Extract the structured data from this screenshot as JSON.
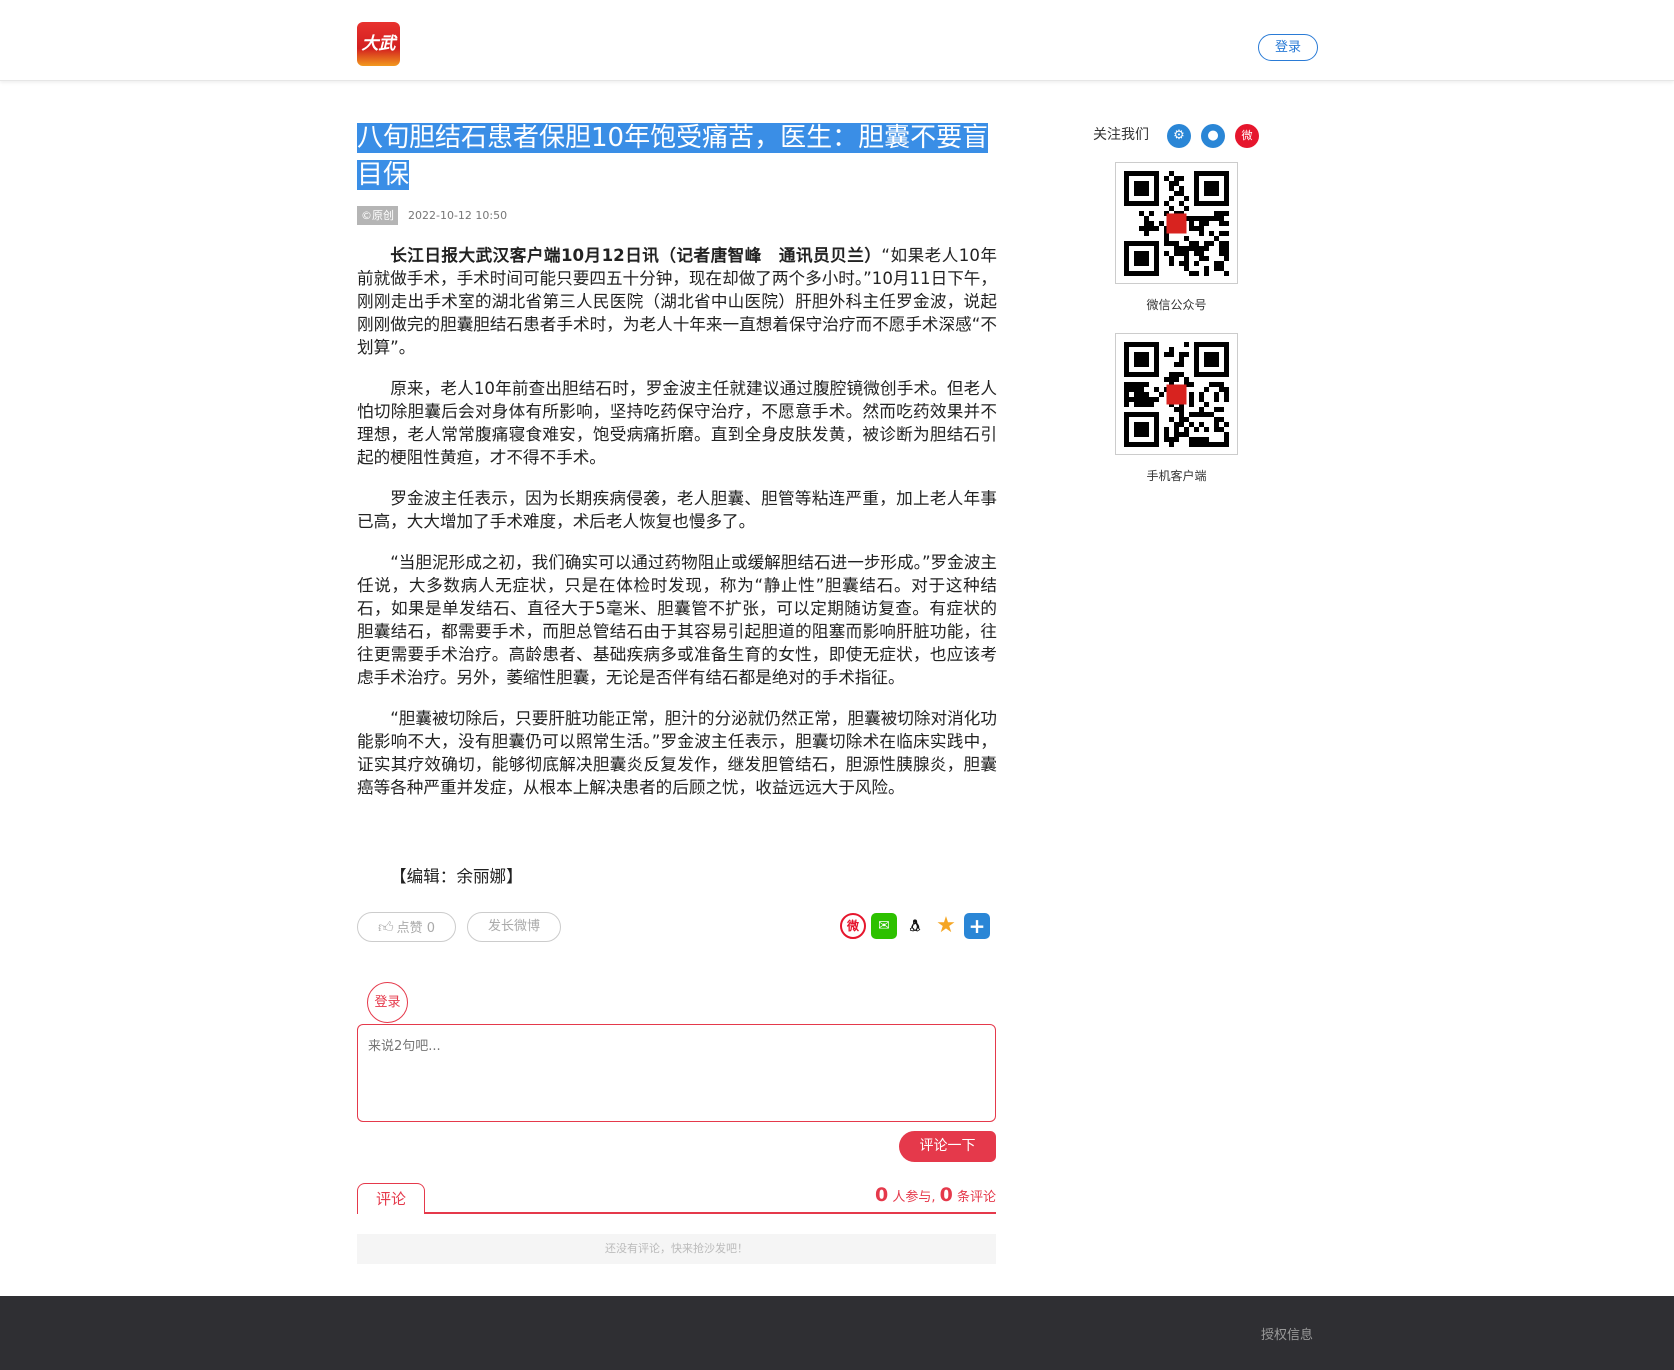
{
  "header": {
    "logo_text": "大武汉",
    "login_label": "登录"
  },
  "article": {
    "title": "八旬胆结石患者保胆10年饱受痛苦，医生：胆囊不要盲目保",
    "badge": "©原创",
    "time": "2022-10-12 10:50",
    "lead_bold": "长江日报大武汉客户端10月12日讯（记者唐智峰　通讯员贝兰）",
    "lead_rest": "“如果老人10年前就做手术，手术时间可能只要四五十分钟，现在却做了两个多小时。”10月11日下午，刚刚走出手术室的湖北省第三人民医院（湖北省中山医院）肝胆外科主任罗金波，说起刚刚做完的胆囊胆结石患者手术时，为老人十年来一直想着保守治疗而不愿手术深感“不划算”。",
    "paragraphs": [
      "原来，老人10年前查出胆结石时，罗金波主任就建议通过腹腔镜微创手术。但老人怕切除胆囊后会对身体有所影响，坚持吃药保守治疗，不愿意手术。然而吃药效果并不理想，老人常常腹痛寝食难安，饱受病痛折磨。直到全身皮肤发黄，被诊断为胆结石引起的梗阻性黄疸，才不得不手术。",
      "罗金波主任表示，因为长期疾病侵袭，老人胆囊、胆管等粘连严重，加上老人年事已高，大大增加了手术难度，术后老人恢复也慢多了。",
      "“当胆泥形成之初，我们确实可以通过药物阻止或缓解胆结石进一步形成。”罗金波主任说，大多数病人无症状，只是在体检时发现，称为“静止性”胆囊结石。对于这种结石，如果是单发结石、直径大于5毫米、胆囊管不扩张，可以定期随访复查。有症状的胆囊结石，都需要手术，而胆总管结石由于其容易引起胆道的阻塞而影响肝脏功能，往往更需要手术治疗。高龄患者、基础疾病多或准备生育的女性，即使无症状，也应该考虑手术治疗。另外，萎缩性胆囊，无论是否伴有结石都是绝对的手术指征。",
      "“胆囊被切除后，只要肝脏功能正常，胆汁的分泌就仍然正常，胆囊被切除对消化功能影响不大，没有胆囊仍可以照常生活。”罗金波主任表示，胆囊切除术在临床实践中，证实其疗效确切，能够彻底解决胆囊炎反复发作，继发胆管结石，胆源性胰腺炎，胆囊癌等各种严重并发症，从根本上解决患者的后顾之忧，收益远远大于风险。"
    ],
    "editor": "【编辑：余丽娜】"
  },
  "actions": {
    "like_label": "点赞",
    "like_count": "0",
    "weibo_post_label": "发长微博",
    "share_icons": [
      "weibo-icon",
      "wechat-icon",
      "qq-icon",
      "qzone-icon",
      "more-icon"
    ]
  },
  "comment": {
    "avatar_login": "登录",
    "placeholder": "来说2句吧...",
    "submit_label": "评论一下",
    "tab_label": "评论",
    "participants": "0",
    "participants_label": "人参与,",
    "comments": "0",
    "comments_label": "条评论",
    "empty_text": "还没有评论，快来抢沙发吧！"
  },
  "sidebar": {
    "follow_label": "关注我们",
    "follow_icons": [
      "android-icon",
      "apple-icon",
      "weibo-icon"
    ],
    "qr1_caption": "微信公众号",
    "qr2_caption": "手机客户端"
  },
  "footer": {
    "link": "授权信息"
  },
  "colors": {
    "accent_red": "#e5394b",
    "accent_blue": "#2a7bd6",
    "title_highlight": "#3a8ee6",
    "footer_bg": "#2f2f33"
  }
}
